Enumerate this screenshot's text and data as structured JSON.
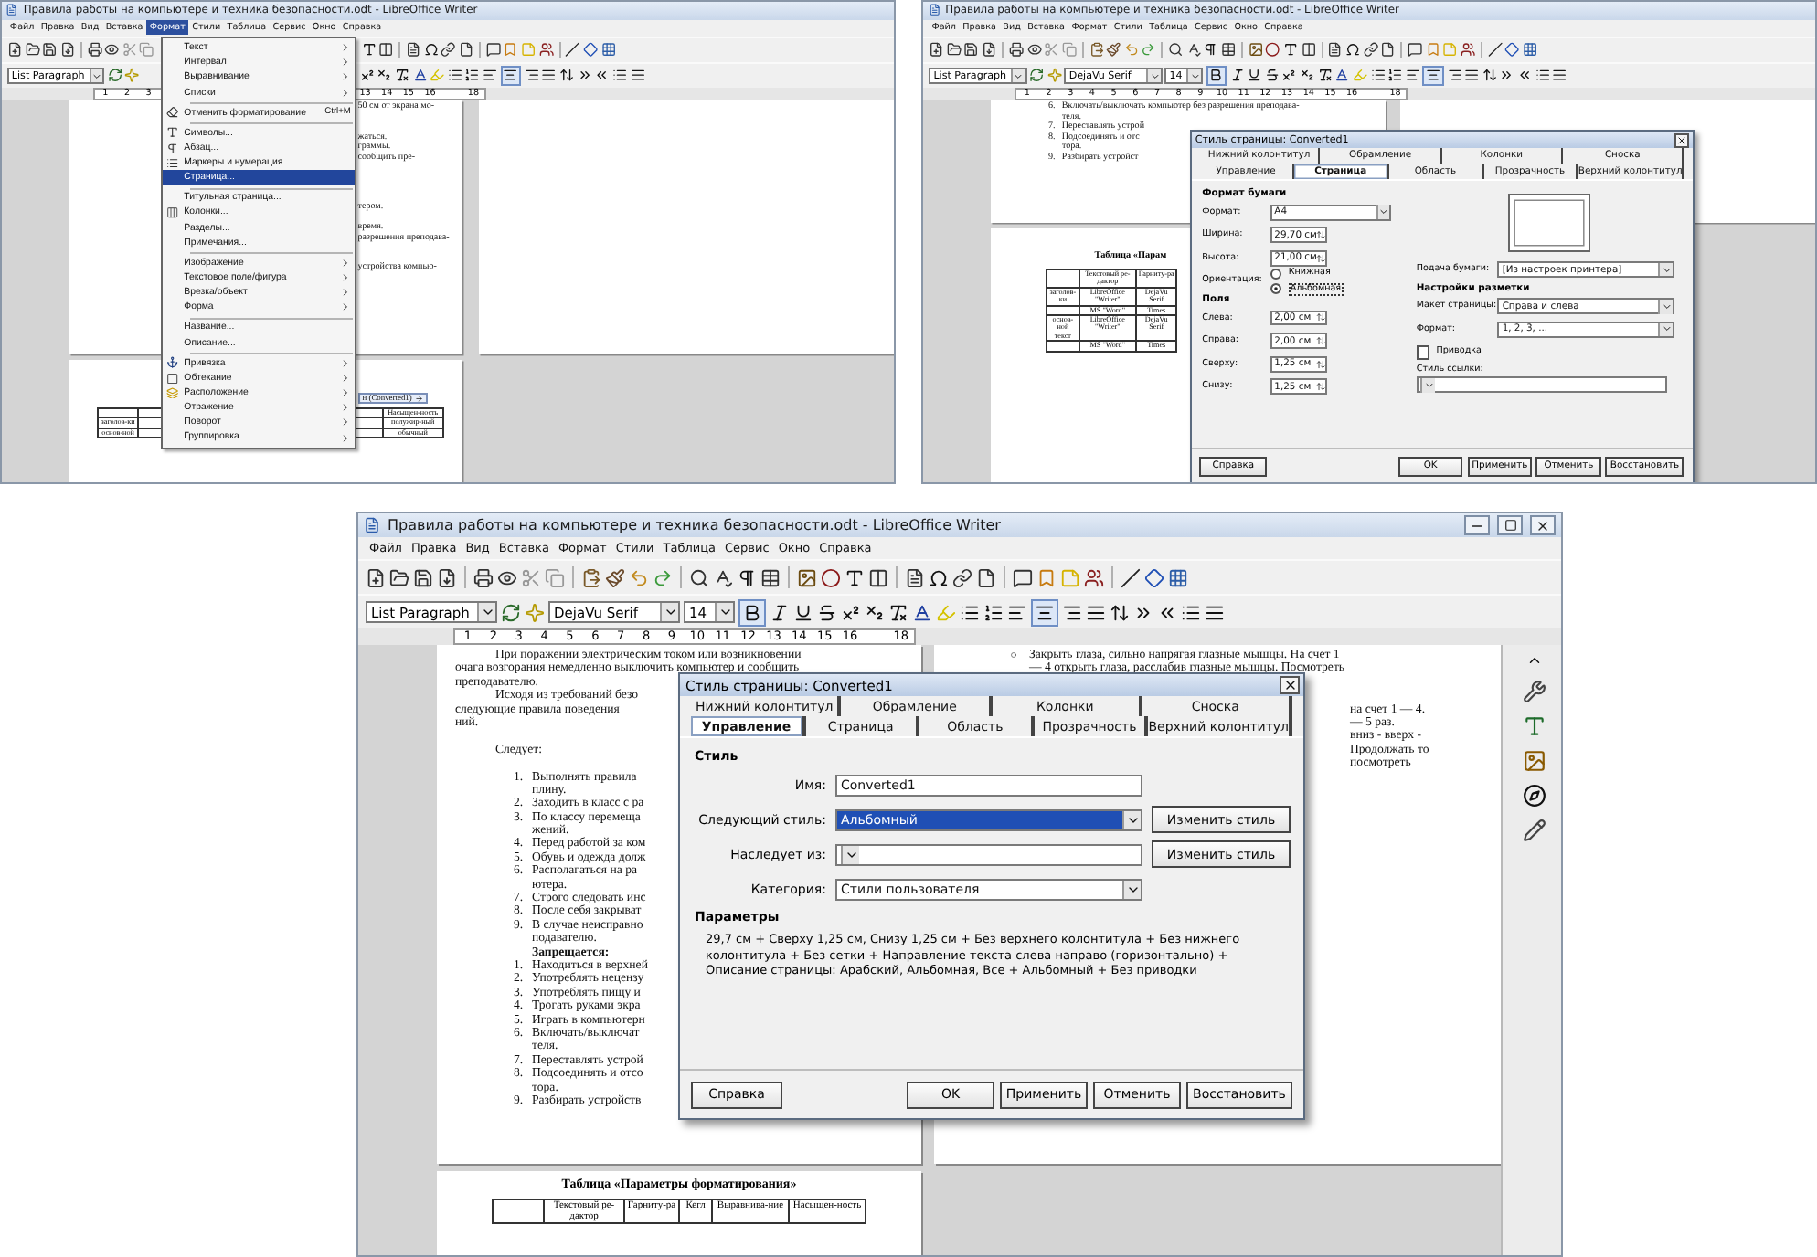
{
  "panels": [
    {
      "title": "Правила работы на компьютере и техника безопасности.odt - LibreOffice Writer",
      "menu": [
        {
          "label": "Файл",
          "selected": false
        },
        {
          "label": "Правка",
          "selected": false
        },
        {
          "label": "Вид",
          "selected": false
        },
        {
          "label": "Вставка",
          "selected": false
        },
        {
          "label": "Формат",
          "selected": true
        },
        {
          "label": "Стили",
          "selected": false
        },
        {
          "label": "Таблица",
          "selected": false
        },
        {
          "label": "Сервис",
          "selected": false
        },
        {
          "label": "Окно",
          "selected": false
        },
        {
          "label": "Справка",
          "selected": false
        }
      ],
      "style_box": "List Paragraph",
      "centered": true,
      "ruler": [
        [
          "1",
          "2",
          "3"
        ],
        [
          "13",
          "14",
          "15",
          "16"
        ],
        [
          "18"
        ]
      ],
      "left_pages": [
        {
          "lines": [
            {
              "kind": "tail",
              "text": "50 см от экрана мо-"
            },
            {
              "kind": "blank"
            },
            {
              "kind": "blank"
            },
            {
              "kind": "tail",
              "text": "жаться."
            },
            {
              "kind": "tail",
              "text": "граммы."
            },
            {
              "kind": "tail",
              "text": "сообщить пре-"
            },
            {
              "kind": "blank"
            },
            {
              "kind": "blank"
            },
            {
              "kind": "blank"
            },
            {
              "kind": "blank"
            },
            {
              "kind": "tail",
              "text": "тером."
            },
            {
              "kind": "blank"
            },
            {
              "kind": "tail",
              "text": "время."
            },
            {
              "kind": "tail",
              "text": "разрешения преподава-"
            },
            {
              "kind": "blank"
            },
            {
              "kind": "blank"
            },
            {
              "kind": "tail",
              "text": "устройства компью-"
            }
          ]
        },
        {
          "lines": [
            {
              "kind": "blank"
            },
            {
              "kind": "blank"
            },
            {
              "kind": "blank"
            },
            {
              "kind": "tag",
              "text": "н (Converted1)"
            }
          ],
          "table": [
            {
              "cells": [
                "Насыщен-ность"
              ]
            },
            {
              "label": "заголов-ки",
              "cells": [
                "полужир-ный"
              ]
            },
            {
              "label": "основ-ной",
              "cells": [
                "обычный"
              ]
            }
          ]
        }
      ],
      "overlay": {
        "kind": "menu",
        "items": [
          {
            "kind": "item",
            "label": "Текст",
            "submenu": true,
            "selected": false
          },
          {
            "kind": "item",
            "label": "Интервал",
            "submenu": true,
            "selected": false
          },
          {
            "kind": "item",
            "label": "Выравнивание",
            "submenu": true,
            "selected": false
          },
          {
            "kind": "item",
            "label": "Списки",
            "submenu": true,
            "selected": false
          },
          {
            "kind": "separator"
          },
          {
            "kind": "item",
            "label": "Отменить форматирование",
            "shortcut": "Ctrl+M",
            "submenu": false,
            "selected": false
          },
          {
            "kind": "separator"
          },
          {
            "kind": "item",
            "label": "Символы...",
            "submenu": false,
            "selected": false
          },
          {
            "kind": "item",
            "label": "Абзац...",
            "submenu": false,
            "selected": false
          },
          {
            "kind": "item",
            "label": "Маркеры и нумерация...",
            "submenu": false,
            "selected": false
          },
          {
            "kind": "item",
            "label": "Страница...",
            "submenu": false,
            "selected": true
          },
          {
            "kind": "separator"
          },
          {
            "kind": "item",
            "label": "Титульная страница...",
            "submenu": false,
            "selected": false
          },
          {
            "kind": "item",
            "label": "Колонки...",
            "submenu": false,
            "selected": false
          },
          {
            "kind": "item",
            "label": "Разделы...",
            "submenu": false,
            "selected": false
          },
          {
            "kind": "item",
            "label": "Примечания...",
            "submenu": false,
            "selected": false
          },
          {
            "kind": "separator"
          },
          {
            "kind": "item",
            "label": "Изображение",
            "submenu": true,
            "selected": false
          },
          {
            "kind": "item",
            "label": "Текстовое поле/фигура",
            "submenu": true,
            "selected": false
          },
          {
            "kind": "item",
            "label": "Врезка/объект",
            "submenu": true,
            "selected": false
          },
          {
            "kind": "item",
            "label": "Форма",
            "submenu": true,
            "selected": false
          },
          {
            "kind": "separator"
          },
          {
            "kind": "item",
            "label": "Название...",
            "submenu": false,
            "selected": false
          },
          {
            "kind": "item",
            "label": "Описание...",
            "submenu": false,
            "selected": false
          },
          {
            "kind": "separator"
          },
          {
            "kind": "item",
            "label": "Привязка",
            "submenu": true,
            "selected": false
          },
          {
            "kind": "item",
            "label": "Обтекание",
            "submenu": true,
            "selected": false
          },
          {
            "kind": "item",
            "label": "Расположение",
            "submenu": true,
            "selected": false
          },
          {
            "kind": "item",
            "label": "Отражение",
            "submenu": true,
            "selected": false
          },
          {
            "kind": "item",
            "label": "Поворот",
            "submenu": true,
            "selected": false
          },
          {
            "kind": "item",
            "label": "Группировка",
            "submenu": true,
            "selected": false
          }
        ]
      }
    },
    {
      "title": "Правила работы на компьютере и техника безопасности.odt - LibreOffice Writer",
      "menu": [
        {
          "label": "Файл",
          "selected": false
        },
        {
          "label": "Правка",
          "selected": false
        },
        {
          "label": "Вид",
          "selected": false
        },
        {
          "label": "Вставка",
          "selected": false
        },
        {
          "label": "Формат",
          "selected": false
        },
        {
          "label": "Стили",
          "selected": false
        },
        {
          "label": "Таблица",
          "selected": false
        },
        {
          "label": "Сервис",
          "selected": false
        },
        {
          "label": "Окно",
          "selected": false
        },
        {
          "label": "Справка",
          "selected": false
        }
      ],
      "style_box": "List Paragraph",
      "font_box": "DejaVu Serif",
      "size_box": "14",
      "bold_on": true,
      "centered": true,
      "ruler": [
        [
          "1",
          "2",
          "3",
          "4",
          "5",
          "6",
          "7",
          "8",
          "9",
          "10",
          "11",
          "12",
          "13",
          "14",
          "15",
          "16"
        ],
        [
          "18"
        ]
      ],
      "left_pages": [
        {
          "lines": [
            {
              "kind": "item",
              "num": "6.",
              "text": "Включать/выключать компьютер без разрешения преподава-"
            },
            {
              "kind": "cont",
              "text": "теля."
            },
            {
              "kind": "item",
              "num": "7.",
              "text": "Переставлять устрой"
            },
            {
              "kind": "item",
              "num": "8.",
              "text": "Подсоединять и отс"
            },
            {
              "kind": "cont",
              "text": "тора."
            },
            {
              "kind": "item",
              "num": "9.",
              "text": "Разбирать устройст"
            }
          ]
        },
        {
          "lines": [
            {
              "kind": "blank"
            },
            {
              "kind": "blank"
            },
            {
              "kind": "title",
              "text": "Таблица «Парам"
            }
          ],
          "table": [
            {
              "cells": [
                "Текстовый ре-дактор",
                "Гарниту-ра"
              ]
            },
            {
              "label": "заголов-ки",
              "cells": [
                "LibreOffice \"Writer\"",
                "DejaVu Serif"
              ]
            },
            {
              "cells": [
                "MS \"Word\"",
                "Times"
              ]
            },
            {
              "label": "основ-ной текст",
              "cells": [
                "LibreOffice \"Writer\"",
                "DejaVu Serif"
              ]
            },
            {
              "cells": [
                "MS \"Word\"",
                "Times"
              ]
            }
          ]
        }
      ],
      "overlay": {
        "kind": "dialog",
        "title": "Стиль страницы: Converted1",
        "tabs_top": [
          {
            "label": "Нижний колонтитул",
            "selected": false
          },
          {
            "label": "Обрамление",
            "selected": false
          },
          {
            "label": "Колонки",
            "selected": false
          },
          {
            "label": "Сноска",
            "selected": false
          }
        ],
        "tabs_bottom": [
          {
            "label": "Управление",
            "selected": false
          },
          {
            "label": "Страница",
            "selected": true
          },
          {
            "label": "Область",
            "selected": false
          },
          {
            "label": "Прозрачность",
            "selected": false
          },
          {
            "label": "Верхний колонтитул",
            "selected": false
          }
        ],
        "body": {
          "kind": "page",
          "paper_heading": "Формат бумаги",
          "paper_fields": [
            {
              "kind": "select",
              "label": "Формат:",
              "value": "A4"
            },
            {
              "kind": "spin",
              "label": "Ширина:",
              "value": "29,70 см"
            },
            {
              "kind": "spin",
              "label": "Высота:",
              "value": "21,00 см"
            }
          ],
          "orientation_label": "Ориентация:",
          "orientation": [
            {
              "label": "Книжная",
              "selected": false
            },
            {
              "label": "Альбомная",
              "selected": true
            }
          ],
          "margins_heading": "Поля",
          "margins": [
            {
              "label": "Слева:",
              "value": "2,00 см"
            },
            {
              "label": "Справа:",
              "value": "2,00 см"
            },
            {
              "label": "Сверху:",
              "value": "1,25 см"
            },
            {
              "label": "Снизу:",
              "value": "1,25 см"
            }
          ],
          "tray": {
            "label": "Подача бумаги:",
            "value": "[Из настроек принтера]"
          },
          "layout_heading": "Настройки разметки",
          "layout_fields": [
            {
              "label": "Макет страницы:",
              "value": "Справа и слева"
            },
            {
              "label": "Формат:",
              "value": "1, 2, 3, ..."
            }
          ],
          "register": {
            "label": "Приводка",
            "checked": false
          },
          "ref_style_label": "Стиль ссылки:"
        },
        "buttons": [
          "Справка",
          "OK",
          "Применить",
          "Отменить",
          "Восстановить"
        ]
      }
    },
    {
      "title": "Правила работы на компьютере и техника безопасности.odt - LibreOffice Writer",
      "window_controls": true,
      "sidebar_visible": true,
      "menu": [
        {
          "label": "Файл",
          "selected": false
        },
        {
          "label": "Правка",
          "selected": false
        },
        {
          "label": "Вид",
          "selected": false
        },
        {
          "label": "Вставка",
          "selected": false
        },
        {
          "label": "Формат",
          "selected": false
        },
        {
          "label": "Стили",
          "selected": false
        },
        {
          "label": "Таблица",
          "selected": false
        },
        {
          "label": "Сервис",
          "selected": false
        },
        {
          "label": "Окно",
          "selected": false
        },
        {
          "label": "Справка",
          "selected": false
        }
      ],
      "style_box": "List Paragraph",
      "font_box": "DejaVu Serif",
      "size_box": "14",
      "bold_on": true,
      "centered": true,
      "ruler": [
        [
          "1",
          "2",
          "3",
          "4",
          "5",
          "6",
          "7",
          "8",
          "9",
          "10",
          "11",
          "12",
          "13",
          "14",
          "15",
          "16"
        ],
        [
          "18"
        ]
      ],
      "left_pages": [
        {
          "lines": [
            {
              "kind": "first",
              "text": "При поражении электрическим током или возникновении"
            },
            {
              "kind": "text",
              "text": "очага возгорания немедленно выключить компьютер и сообщить"
            },
            {
              "kind": "text",
              "text": "преподавателю."
            },
            {
              "kind": "first",
              "text": "Исходя из требований безо"
            },
            {
              "kind": "text",
              "text": "следующие правила поведения"
            },
            {
              "kind": "text",
              "text": "ний."
            },
            {
              "kind": "blank"
            },
            {
              "kind": "first",
              "text": "Следует:"
            },
            {
              "kind": "blank"
            },
            {
              "kind": "item",
              "num": "1.",
              "text": "Выполнять правила"
            },
            {
              "kind": "cont",
              "text": "плину."
            },
            {
              "kind": "item",
              "num": "2.",
              "text": "Заходить в класс с ра"
            },
            {
              "kind": "item",
              "num": "3.",
              "text": "По классу перемеща"
            },
            {
              "kind": "cont",
              "text": "жений."
            },
            {
              "kind": "item",
              "num": "4.",
              "text": "Перед работой за ком"
            },
            {
              "kind": "item",
              "num": "5.",
              "text": "Обувь и одежда долж"
            },
            {
              "kind": "item",
              "num": "6.",
              "text": "Располагаться на ра"
            },
            {
              "kind": "cont",
              "text": "ютера."
            },
            {
              "kind": "item",
              "num": "7.",
              "text": "Строго следовать инс"
            },
            {
              "kind": "item",
              "num": "8.",
              "text": "После себя закрыват"
            },
            {
              "kind": "item",
              "num": "9.",
              "text": "В случае неисправно"
            },
            {
              "kind": "cont",
              "text": "подавателю."
            },
            {
              "kind": "heading",
              "text": "Запрещается:"
            },
            {
              "kind": "item",
              "num": "1.",
              "text": "Находиться в верхней"
            },
            {
              "kind": "item",
              "num": "2.",
              "text": "Употреблять нецензу"
            },
            {
              "kind": "item",
              "num": "3.",
              "text": "Употреблять пищу и"
            },
            {
              "kind": "item",
              "num": "4.",
              "text": "Трогать руками экра"
            },
            {
              "kind": "item",
              "num": "5.",
              "text": "Играть в компьютерн"
            },
            {
              "kind": "item",
              "num": "6.",
              "text": "Включать/выключат"
            },
            {
              "kind": "cont",
              "text": "теля."
            },
            {
              "kind": "item",
              "num": "7.",
              "text": "Переставлять устрой"
            },
            {
              "kind": "item",
              "num": "8.",
              "text": "Подсоединять и отсо"
            },
            {
              "kind": "cont",
              "text": "тора."
            },
            {
              "kind": "item",
              "num": "9.",
              "text": "Разбирать устройств"
            }
          ]
        },
        {
          "lines": [
            {
              "kind": "title",
              "text": "Таблица «Параметры форматирования»"
            }
          ],
          "table": [
            {
              "cells": [
                "Текстовый ре-дактор",
                "Гарниту-ра",
                "Кегл",
                "Выравнива-ние",
                "Насыщен-ность"
              ]
            }
          ]
        }
      ],
      "right_pages": [
        {
          "lines": [
            {
              "kind": "bullet",
              "text": "Закрыть глаза, сильно напрягая глазные мышцы. На счет 1"
            },
            {
              "kind": "cont",
              "text": "— 4 открыть глаза, расслабив глазные мышцы. Посмотреть"
            },
            {
              "kind": "blank"
            },
            {
              "kind": "blank"
            },
            {
              "kind": "tail",
              "text": "на счет 1 — 4."
            },
            {
              "kind": "tail",
              "text": "— 5 раз."
            },
            {
              "kind": "tail",
              "text": "вниз - вверх -"
            },
            {
              "kind": "tail",
              "text": "Продолжать то"
            },
            {
              "kind": "tail",
              "text": "посмотреть"
            }
          ]
        }
      ],
      "overlay": {
        "kind": "dialog",
        "title": "Стиль страницы: Converted1",
        "tabs_top": [
          {
            "label": "Нижний колонтитул",
            "selected": false
          },
          {
            "label": "Обрамление",
            "selected": false
          },
          {
            "label": "Колонки",
            "selected": false
          },
          {
            "label": "Сноска",
            "selected": false
          }
        ],
        "tabs_bottom": [
          {
            "label": "Управление",
            "selected": true
          },
          {
            "label": "Страница",
            "selected": false
          },
          {
            "label": "Область",
            "selected": false
          },
          {
            "label": "Прозрачность",
            "selected": false
          },
          {
            "label": "Верхний колонтитул",
            "selected": false
          }
        ],
        "body": {
          "kind": "organizer",
          "heading": "Стиль",
          "fields": [
            {
              "kind": "text",
              "label": "Имя:",
              "value": "Converted1"
            },
            {
              "kind": "select",
              "label": "Следующий стиль:",
              "value": "Альбомный",
              "highlighted": true,
              "button": "Изменить стиль"
            },
            {
              "kind": "select",
              "label": "Наследует из:",
              "button": "Изменить стиль"
            },
            {
              "kind": "select",
              "label": "Категория:",
              "value": "Стили пользователя"
            }
          ],
          "params_heading": "Параметры",
          "params": "29,7 см + Сверху 1,25 см, Снизу 1,25 см + Без верхнего колонтитула + Без нижнего колонтитула + Без сетки + Направление текста слева направо (горизонтально) + Описание страницы: Арабский, Альбомная, Все + Альбомный + Без приводки"
        },
        "buttons": [
          "Справка",
          "OK",
          "Применить",
          "Отменить",
          "Восстановить"
        ]
      }
    }
  ]
}
